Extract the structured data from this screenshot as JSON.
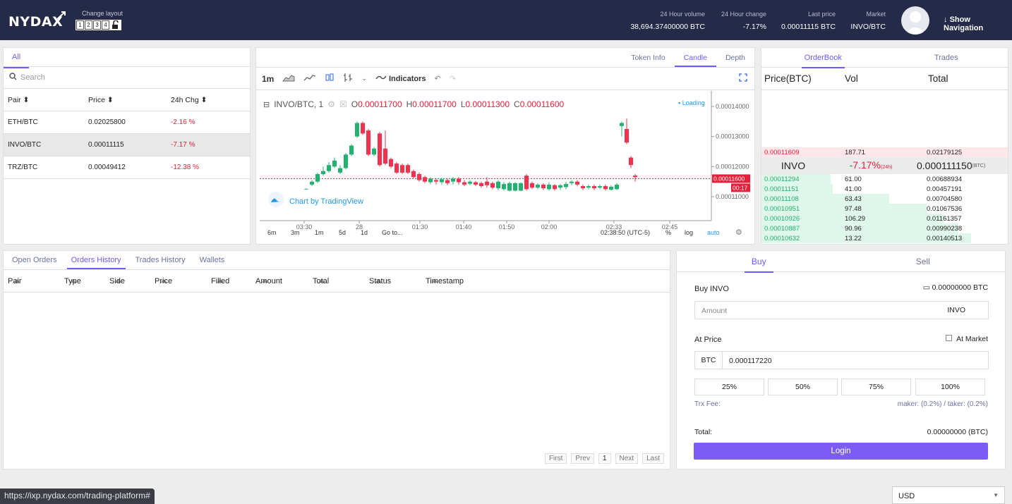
{
  "header": {
    "logo": "NYDA",
    "logo_x": "X",
    "change_layout_label": "Change layout",
    "layouts": [
      "1",
      "2",
      "3",
      "4"
    ],
    "stats": [
      {
        "label": "24 Hour volume",
        "value": "38,694.37400000 BTC"
      },
      {
        "label": "24 Hour change",
        "value": "-7.17%"
      },
      {
        "label": "Last price",
        "value": "0.00011115 BTC"
      },
      {
        "label": "Market",
        "value": "INVO/BTC"
      }
    ],
    "show_navigation": "Show Navigation"
  },
  "pairs": {
    "tab": "All",
    "search_placeholder": "Search",
    "columns": [
      "Pair",
      "Price",
      "24h Chg"
    ],
    "rows": [
      {
        "pair": "ETH/BTC",
        "price": "0.02025800",
        "chg": "-2.16 %"
      },
      {
        "pair": "INVO/BTC",
        "price": "0.00011115",
        "chg": "-7.17 %"
      },
      {
        "pair": "TRZ/BTC",
        "price": "0.00049412",
        "chg": "-12.38 %"
      }
    ]
  },
  "chart": {
    "tabs": [
      "Token Info",
      "Candle",
      "Depth"
    ],
    "interval": "1m",
    "indicators": "Indicators",
    "symbol": "INVO/BTC, 1",
    "ohlc": {
      "O": "0.00011700",
      "H": "0.00011700",
      "L": "0.00011300",
      "C": "0.00011600"
    },
    "loading": "Loading",
    "attribution": "Chart by TradingView",
    "yticks": [
      "0.00014000",
      "0.00013000",
      "0.00012000",
      "0.00011000"
    ],
    "price_tag": "0.00011600",
    "countdown": "00:17",
    "xticks": [
      "03:30",
      "28",
      "01:30",
      "01:40",
      "01:50",
      "02:00",
      "02:33",
      "02:45"
    ],
    "ranges": [
      "6m",
      "3m",
      "1m",
      "5d",
      "1d",
      "Go to..."
    ],
    "time": "02:38:50 (UTC-5)",
    "pct": "%",
    "log": "log",
    "auto": "auto"
  },
  "orderbook": {
    "tabs": [
      "OrderBook",
      "Trades"
    ],
    "columns": [
      "Price(BTC)",
      "Vol",
      "Total"
    ],
    "asks": [
      {
        "price": "0.00011609",
        "vol": "187.71",
        "total": "0.02179125"
      }
    ],
    "mid": {
      "sym": "INVO",
      "chg": "-7.17%",
      "chg_sub": "(24h)",
      "price": "0.000111150",
      "unit": "(BTC)"
    },
    "bids": [
      {
        "price": "0.00011294",
        "vol": "61.00",
        "total": "0.00688934",
        "depth": 0.28
      },
      {
        "price": "0.00011151",
        "vol": "41.00",
        "total": "0.00457191",
        "depth": 0.29
      },
      {
        "price": "0.00011108",
        "vol": "63.43",
        "total": "0.00704580",
        "depth": 0.52
      },
      {
        "price": "0.00010951",
        "vol": "97.48",
        "total": "0.01067536",
        "depth": 0.67
      },
      {
        "price": "0.00010926",
        "vol": "106.29",
        "total": "0.01161357",
        "depth": 0.74
      },
      {
        "price": "0.00010887",
        "vol": "90.96",
        "total": "0.00990238",
        "depth": 0.8
      },
      {
        "price": "0.00010632",
        "vol": "13.22",
        "total": "0.00140513",
        "depth": 0.85
      }
    ]
  },
  "orders": {
    "tabs": [
      "Open Orders",
      "Orders History",
      "Trades History",
      "Wallets"
    ],
    "columns": [
      "Pair",
      "Type",
      "Side",
      "Price",
      "Filled",
      "Amount",
      "Total",
      "Status",
      "Timestamp"
    ],
    "pager": [
      "First",
      "Prev",
      "1",
      "Next",
      "Last"
    ]
  },
  "trade": {
    "tabs": [
      "Buy",
      "Sell"
    ],
    "buy_label": "Buy INVO",
    "balance": "0.00000000 BTC",
    "amount_placeholder": "Amount",
    "amount_unit": "INVO",
    "at_price": "At Price",
    "at_market": "At Market",
    "price_unit": "BTC",
    "price_value": "0.000117220",
    "percents": [
      "25%",
      "50%",
      "75%",
      "100%"
    ],
    "fee_label": "Trx Fee:",
    "fee_value": "maker: (0.2%) / taker: (0.2%)",
    "total_label": "Total:",
    "total_value": "0.00000000 (BTC)",
    "login": "Login"
  },
  "status_url": "https://ixp.nydax.com/trading-platform#",
  "currency": "USD",
  "colors": {
    "accent": "#6b5cff",
    "up": "#21b26f",
    "down": "#e91e3a",
    "header": "#242a47"
  }
}
